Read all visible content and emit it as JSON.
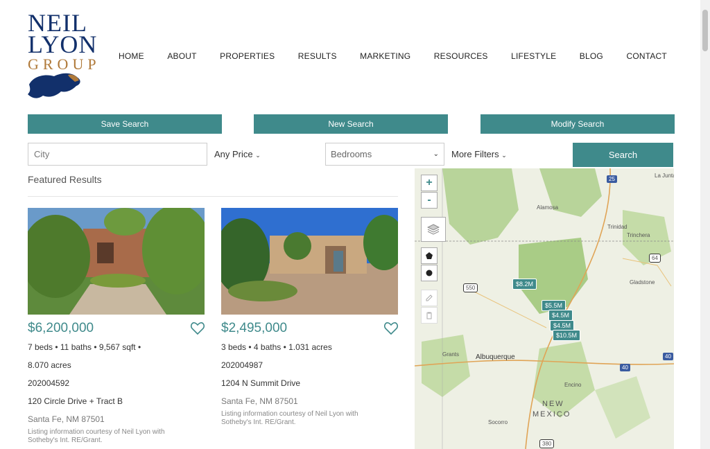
{
  "logo": {
    "line1": "NEIL",
    "line2": "LYON",
    "line3": "GROUP"
  },
  "nav": [
    "HOME",
    "ABOUT",
    "PROPERTIES",
    "RESULTS",
    "MARKETING",
    "RESOURCES",
    "LIFESTYLE",
    "BLOG",
    "CONTACT"
  ],
  "actions": {
    "save": "Save Search",
    "new": "New Search",
    "modify": "Modify Search"
  },
  "search": {
    "city_placeholder": "City",
    "price": "Any Price",
    "bedrooms": "Bedrooms",
    "filters": "More Filters",
    "search_label": "Search"
  },
  "featured": {
    "title": "Featured Results"
  },
  "listings": [
    {
      "price": "$6,200,000",
      "details": "7  beds • 11  baths • 9,567 sqft •",
      "details2": "8.070 acres",
      "mls": "202004592",
      "address": "120 Circle Drive + Tract B",
      "city": "Santa Fe, NM 87501",
      "courtesy": "Listing information courtesy of Neil Lyon with Sotheby's Int. RE/Grant."
    },
    {
      "price": "$2,495,000",
      "details": "3  beds • 4  baths • 1.031 acres",
      "mls": "202004987",
      "address": "1204 N Summit Drive",
      "city": "Santa Fe, NM 87501",
      "courtesy": "Listing information courtesy of Neil Lyon with Sotheby's Int. RE/Grant."
    }
  ],
  "map": {
    "zoom_in": "+",
    "zoom_out": "-",
    "places": [
      "Alamosa",
      "Trinidad",
      "Trinchera",
      "Gladstone",
      "Grants",
      "Albuquerque",
      "Encino",
      "Socorro",
      "La Junta"
    ],
    "state_label_1": "NEW",
    "state_label_2": "MEXICO",
    "shields": [
      "25",
      "64",
      "550",
      "40",
      "40",
      "380"
    ],
    "markers": [
      "$8.2M",
      "$5.5M",
      "$4.5M",
      "$4.5M",
      "$10.5M"
    ]
  },
  "colors": {
    "accent": "#3f8a8b",
    "logo_blue": "#12306b",
    "logo_gold": "#b07a3a"
  }
}
